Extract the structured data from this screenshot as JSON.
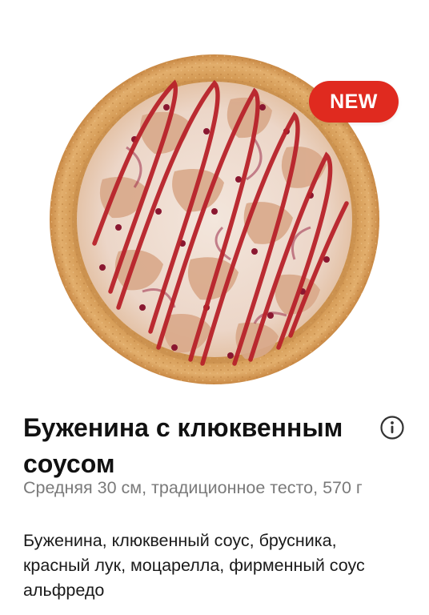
{
  "badge": {
    "label": "NEW",
    "color": "#e02a1f"
  },
  "product": {
    "title": "Буженина с клюквенным соусом",
    "size_description": "Средняя 30 см, традиционное тесто, 570 г",
    "ingredients": "Буженина, клюквенный соус, брусника, красный лук, моцарелла, фирменный соус альфредо"
  },
  "icons": {
    "info": "info-circle-icon"
  }
}
